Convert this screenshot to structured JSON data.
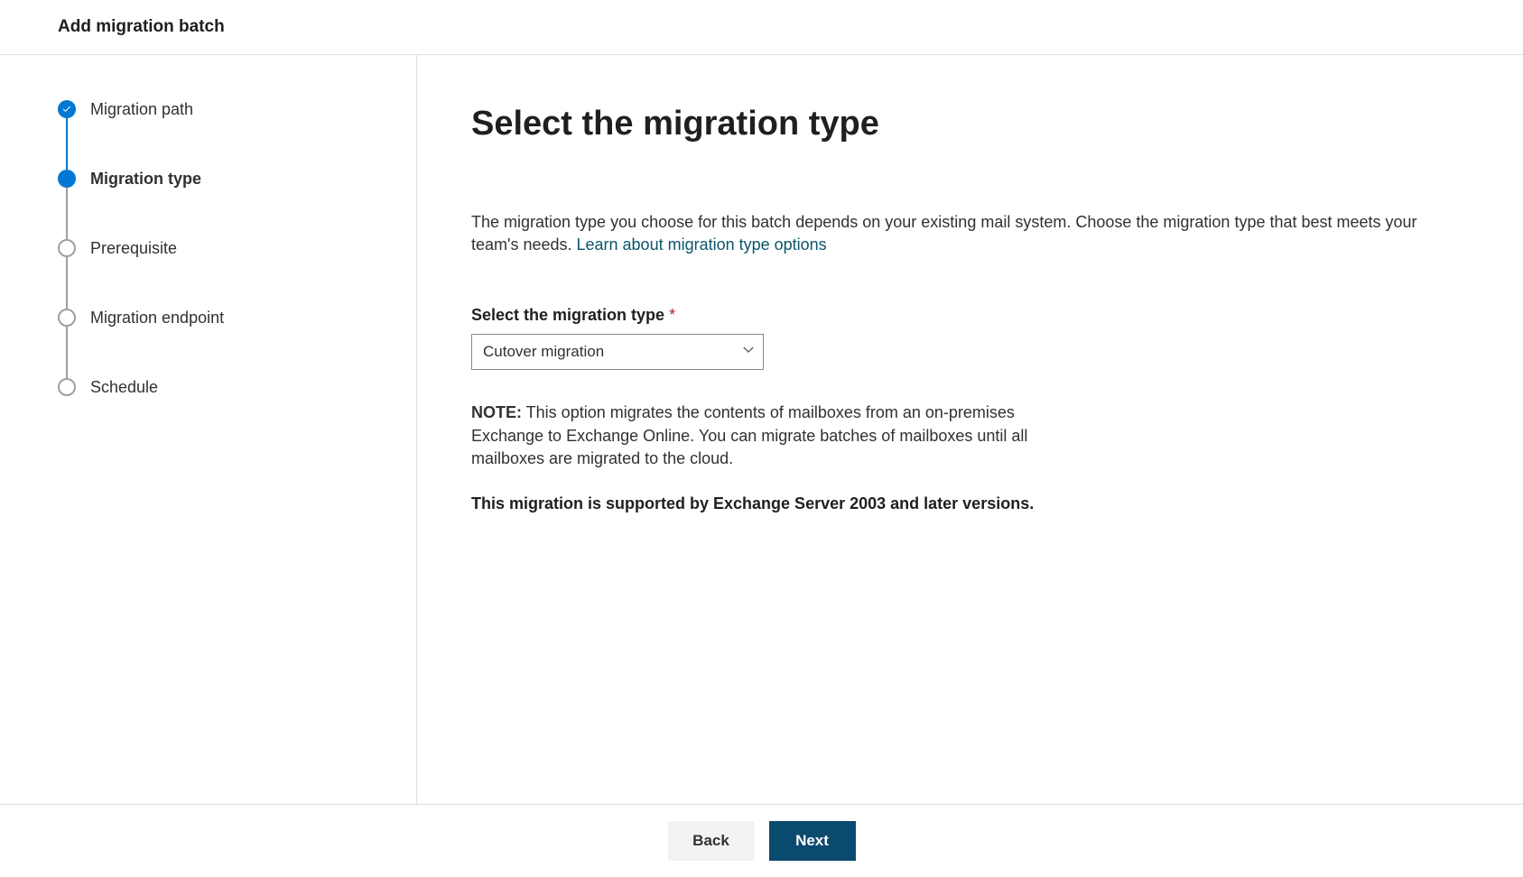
{
  "header": {
    "title": "Add migration batch"
  },
  "steps": [
    {
      "label": "Migration path",
      "state": "completed"
    },
    {
      "label": "Migration type",
      "state": "current"
    },
    {
      "label": "Prerequisite",
      "state": "upcoming"
    },
    {
      "label": "Migration endpoint",
      "state": "upcoming"
    },
    {
      "label": "Schedule",
      "state": "upcoming"
    }
  ],
  "main": {
    "title": "Select the migration type",
    "description_text": "The migration type you choose for this batch depends on your existing mail system. Choose the migration type that best meets your team's needs. ",
    "description_link": "Learn about migration type options",
    "field_label": "Select the migration type",
    "required_mark": "*",
    "select_value": "Cutover migration",
    "note_prefix": "NOTE:",
    "note_body": " This option migrates the contents of mailboxes from an on-premises Exchange to Exchange Online. You can migrate batches of mailboxes until all mailboxes are migrated to the cloud.",
    "support_text": "This migration is supported by Exchange Server 2003 and later versions."
  },
  "footer": {
    "back_label": "Back",
    "next_label": "Next"
  }
}
